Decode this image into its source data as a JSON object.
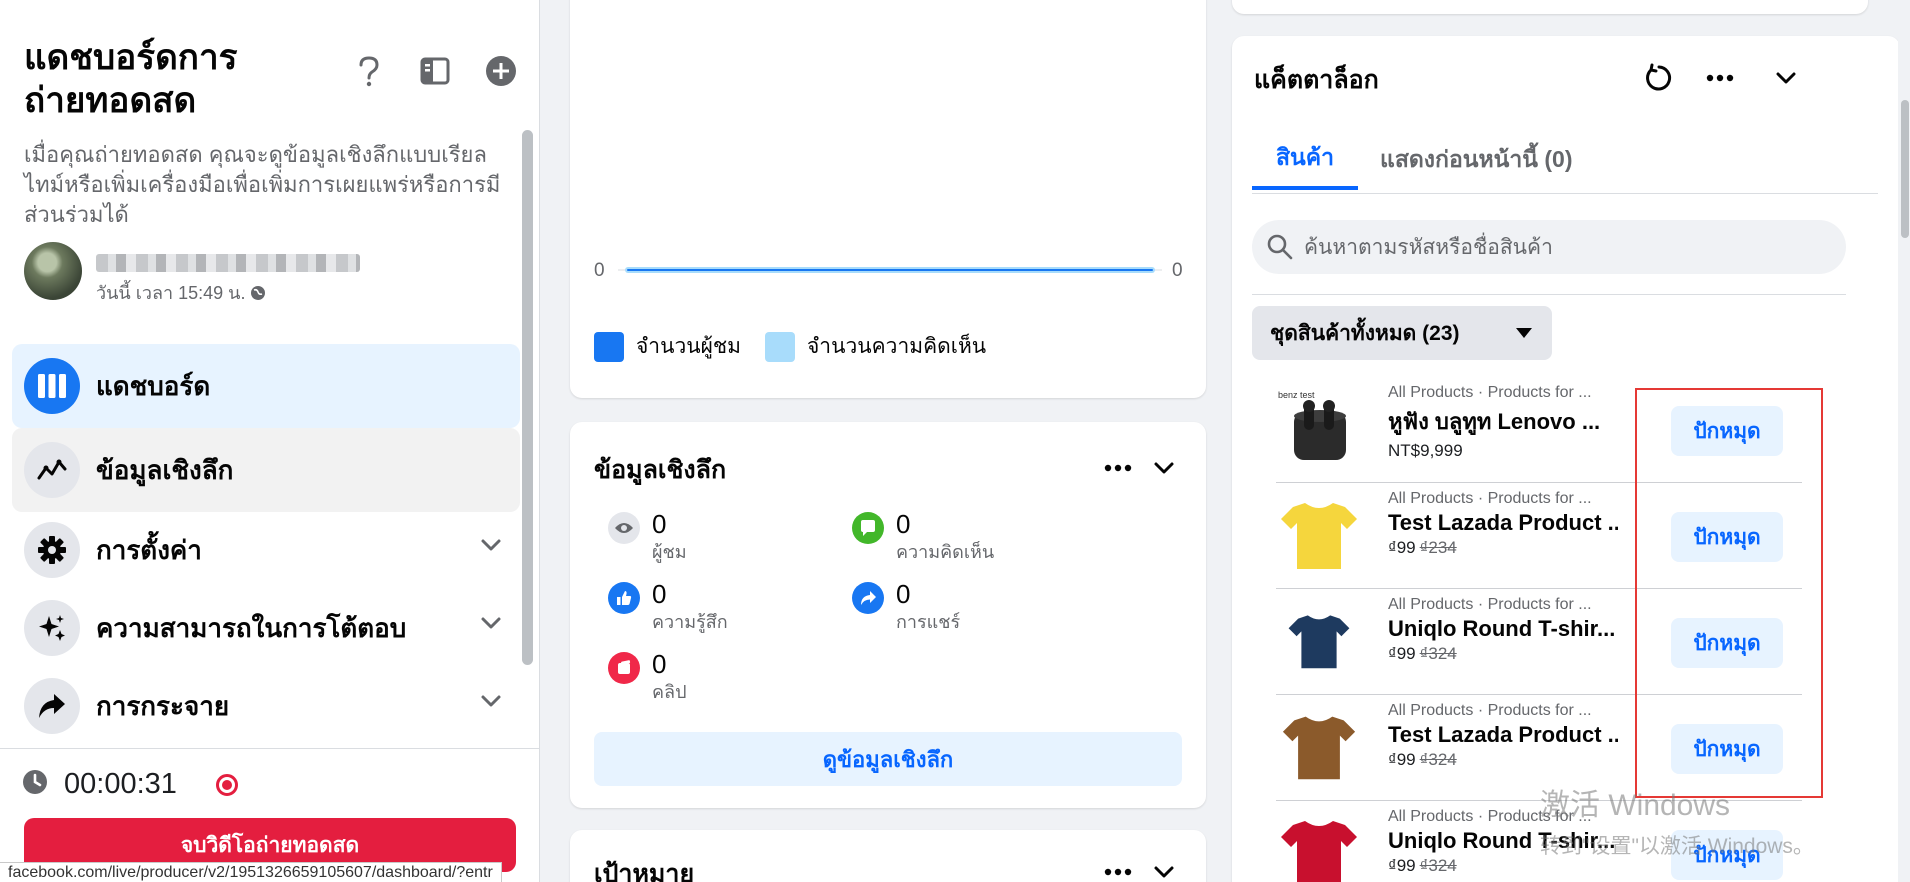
{
  "sidebar": {
    "title": "แดชบอร์ดการถ่ายทอดสด",
    "description": "เมื่อคุณถ่ายทอดสด คุณจะดูข้อมูลเชิงลึกแบบเรียลไทม์หรือเพิ่มเครื่องมือเพื่อเพิ่มการเผยแพร่หรือการมีส่วนร่วมได้",
    "header_icons": [
      "help-icon",
      "panel-toggle-icon",
      "add-icon"
    ],
    "profile": {
      "time": "วันนี้ เวลา 15:49 น."
    },
    "nav": [
      {
        "label": "แดชบอร์ด",
        "icon": "dashboard-icon",
        "state": "active"
      },
      {
        "label": "ข้อมูลเชิงลึก",
        "icon": "insights-icon",
        "state": "hover"
      },
      {
        "label": "การตั้งค่า",
        "icon": "gear-icon",
        "state": "collapsed"
      },
      {
        "label": "ความสามารถในการโต้ตอบ",
        "icon": "sparkle-icon",
        "state": "collapsed"
      },
      {
        "label": "การกระจาย",
        "icon": "share-icon",
        "state": "collapsed"
      }
    ],
    "timer": "00:00:31",
    "end_button": "จบวิดีโอถ่ายทอดสด"
  },
  "chart_card": {
    "legend": [
      {
        "label": "จำนวนผู้ชม",
        "color": "#1877f2"
      },
      {
        "label": "จำนวนความคิดเห็น",
        "color": "#a8dcfb"
      }
    ]
  },
  "chart_data": {
    "type": "line",
    "series": [
      {
        "name": "จำนวนผู้ชม",
        "values": [
          0
        ]
      },
      {
        "name": "จำนวนความคิดเห็น",
        "values": [
          0
        ]
      }
    ],
    "y_left_label": "0",
    "y_right_label": "0"
  },
  "insights": {
    "title": "ข้อมูลเชิงลึก",
    "metrics": [
      {
        "value": "0",
        "label": "ผู้ชม",
        "icon": "eye-icon",
        "color": "#65676b"
      },
      {
        "value": "0",
        "label": "ความคิดเห็น",
        "icon": "comment-icon",
        "color": "#42b72a"
      },
      {
        "value": "0",
        "label": "ความรู้สึก",
        "icon": "like-icon",
        "color": "#1877f2"
      },
      {
        "value": "0",
        "label": "การแชร์",
        "icon": "share-arrow-icon",
        "color": "#1877f2"
      },
      {
        "value": "0",
        "label": "คลิป",
        "icon": "clip-icon",
        "color": "#f02849"
      }
    ],
    "see_button": "ดูข้อมูลเชิงลึก"
  },
  "goals": {
    "title": "เป้าหมาย"
  },
  "catalog": {
    "title": "แค็ตตาล็อก",
    "tabs": [
      "สินค้า",
      "แสดงก่อนหน้านี้ (0)"
    ],
    "search_placeholder": "ค้นหาตามรหัสหรือชื่อสินค้า",
    "filter": "ชุดสินค้าทั้งหมด (23)",
    "pin_label": "ปักหมุด",
    "products": [
      {
        "category": "All Products · Products for ...",
        "name": "หูฟัง บลูทูท Lenovo ...",
        "price": "NT$9,999",
        "old_price": "",
        "thumb": "earbuds",
        "thumb_text": "benz test"
      },
      {
        "category": "All Products · Products for ...",
        "name": "Test Lazada Product ...",
        "price": "₫99",
        "old_price": "₫234",
        "thumb": "tshirt",
        "color": "#f5d63d"
      },
      {
        "category": "All Products · Products for ...",
        "name": "Uniqlo Round T-shir...",
        "price": "₫99",
        "old_price": "₫324",
        "thumb": "tshirt",
        "color": "#1e3a5f"
      },
      {
        "category": "All Products · Products for ...",
        "name": "Test Lazada Product ...",
        "price": "₫99",
        "old_price": "₫324",
        "thumb": "tshirt",
        "color": "#8b5a2b"
      },
      {
        "category": "All Products · Products for ...",
        "name": "Uniqlo Round T-shir...",
        "price": "₫99",
        "old_price": "₫324",
        "thumb": "tshirt",
        "color": "#c8102e"
      }
    ]
  },
  "watermark": {
    "line1": "激活 Windows",
    "line2": "转到\"设置\"以激活 Windows。"
  },
  "status_url": "facebook.com/live/producer/v2/1951326659105607/dashboard/?entr"
}
